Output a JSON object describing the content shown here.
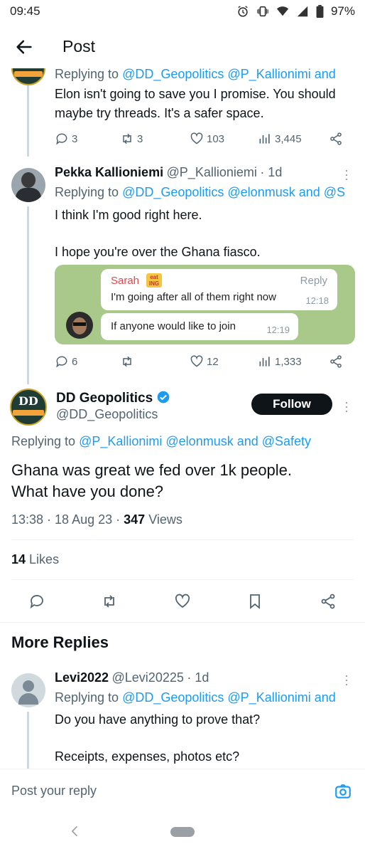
{
  "status_bar": {
    "time": "09:45",
    "battery": "97%"
  },
  "app_bar": {
    "title": "Post"
  },
  "reply1": {
    "replying_prefix": "Replying to",
    "replying_to": "@DD_Geopolitics @P_Kallionimi and",
    "text": "Elon isn't going to save you I promise. You should maybe try threads. It's a safer space.",
    "stats": {
      "replies": "3",
      "reposts": "3",
      "likes": "103",
      "views": "3,445"
    }
  },
  "reply2": {
    "name": "Pekka Kallioniemi",
    "handle": "@P_Kallioniemi",
    "time": "· 1d",
    "replying_prefix": "Replying to",
    "replying_to": "@DD_Geopolitics @elonmusk and @S",
    "text_line1": "I think I'm good right here.",
    "text_line2": "I hope you're over the Ghana fiasco.",
    "chat": {
      "sender": "Sarah",
      "sticker": "eat ING",
      "reply_label": "Reply",
      "msg1": "I'm going after all of them right now",
      "msg1_time": "12:18",
      "msg2": "If anyone would like to join",
      "msg2_time": "12:19"
    },
    "stats": {
      "replies": "6",
      "likes": "12",
      "views": "1,333"
    }
  },
  "main_post": {
    "name": "DD Geopolitics",
    "handle": "@DD_Geopolitics",
    "follow_label": "Follow",
    "replying_prefix": "Replying to",
    "replying_to": "@P_Kallionimi @elonmusk and @Safety",
    "text_line1": "Ghana was great we fed over 1k people.",
    "text_line2": "What have you done?",
    "timestamp": "13:38 · 18 Aug 23 ·",
    "views_count": "347",
    "views_label": "Views",
    "likes_count": "14",
    "likes_label": "Likes"
  },
  "more_replies": {
    "heading": "More Replies",
    "reply": {
      "name": "Levi2022",
      "handle": "@Levi20225",
      "time": "· 1d",
      "replying_prefix": "Replying to",
      "replying_to": "@DD_Geopolitics @P_Kallionimi and",
      "text_line1": "Do you have anything to prove that?",
      "text_line2": "Receipts, expenses, photos etc?"
    }
  },
  "reply_input": {
    "placeholder": "Post your reply"
  },
  "colors": {
    "accent": "#1d9bf0",
    "text": "#0f1419",
    "muted": "#536471",
    "verified": "#1d9bf0"
  }
}
